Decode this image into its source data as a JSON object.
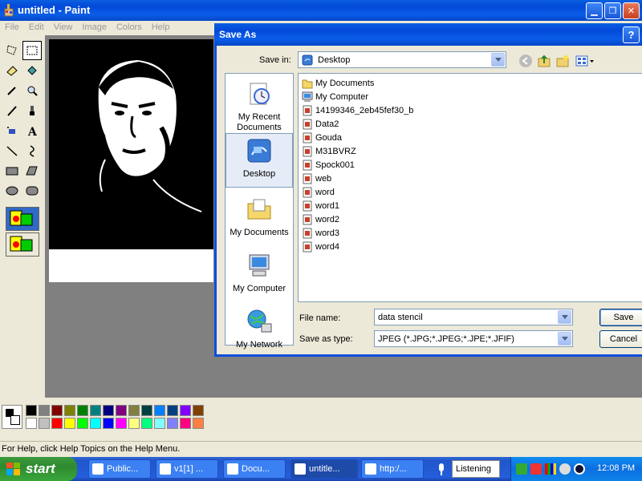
{
  "paint": {
    "title": "untitled - Paint",
    "menu": [
      "File",
      "Edit",
      "View",
      "Image",
      "Colors",
      "Help"
    ],
    "status": "For Help, click Help Topics on the Help Menu."
  },
  "palette": {
    "colors": [
      "#000000",
      "#808080",
      "#800000",
      "#808000",
      "#008000",
      "#008080",
      "#000080",
      "#800080",
      "#808040",
      "#004040",
      "#0080ff",
      "#004080",
      "#8000ff",
      "#804000",
      "#ffffff",
      "#c0c0c0",
      "#ff0000",
      "#ffff00",
      "#00ff00",
      "#00ffff",
      "#0000ff",
      "#ff00ff",
      "#ffff80",
      "#00ff80",
      "#80ffff",
      "#8080ff",
      "#ff0080",
      "#ff8040"
    ]
  },
  "dialog": {
    "title": "Save As",
    "help": "?",
    "save_in_label": "Save in:",
    "save_in_value": "Desktop",
    "places": [
      "My Recent Documents",
      "Desktop",
      "My Documents",
      "My Computer",
      "My Network"
    ],
    "files": [
      "My Documents",
      "My Computer",
      "14199346_2eb45fef30_b",
      "Data2",
      "Gouda",
      "M31BVRZ",
      "Spock001",
      "web",
      "word",
      "word1",
      "word2",
      "word3",
      "word4"
    ],
    "filename_label": "File name:",
    "filename_value": "data stencil",
    "type_label": "Save as type:",
    "type_value": "JPEG (*.JPG;*.JPEG;*.JPE;*.JFIF)",
    "save_button": "Save",
    "cancel_button": "Cancel"
  },
  "taskbar": {
    "start": "start",
    "tasks": [
      "Public...",
      "v1[1] ...",
      "Docu...",
      "untitle...",
      "http:/..."
    ],
    "listening": "Listening",
    "clock": "12:08 PM"
  }
}
